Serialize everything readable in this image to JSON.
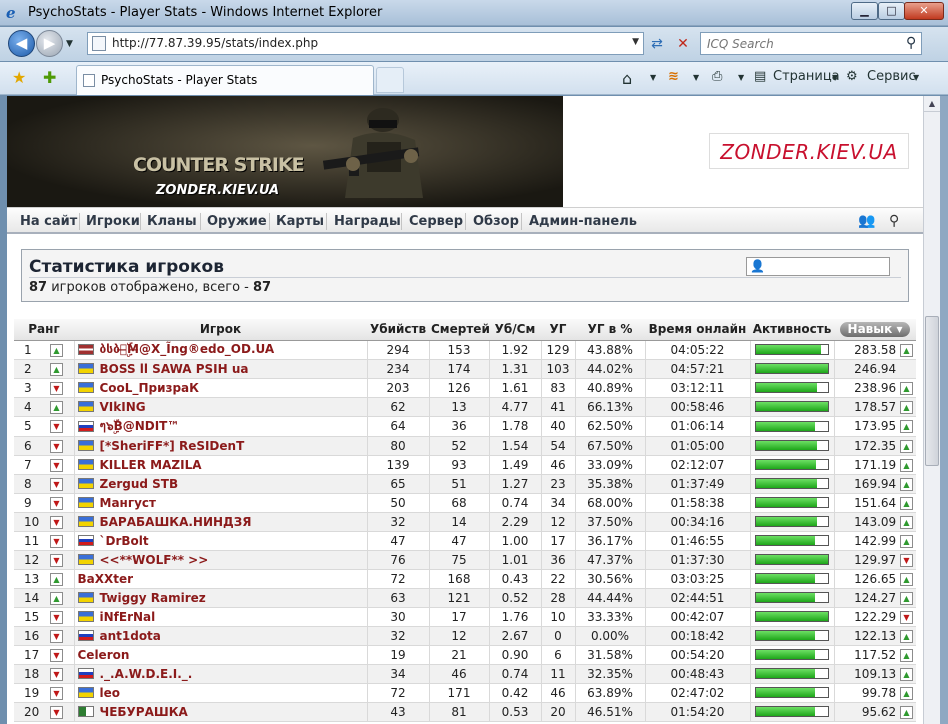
{
  "window": {
    "title": "PsychoStats - Player Stats - Windows Internet Explorer",
    "min": "▁",
    "max": "□",
    "close": "✕"
  },
  "address": {
    "url": "http://77.87.39.95/stats/index.php",
    "search_placeholder": "ICQ Search"
  },
  "tab": {
    "label": "PsychoStats - Player Stats"
  },
  "tools": {
    "page": "Страница",
    "service": "Сервис"
  },
  "icons": {
    "back": "arrow-left-icon",
    "forward": "arrow-right-icon",
    "refresh": "refresh-icon",
    "stop": "stop-icon",
    "search": "search-icon",
    "home": "home-icon",
    "feeds": "rss-icon",
    "print": "print-icon",
    "favorites": "star-icon",
    "add_favorite": "add-favorite-icon",
    "users": "users-icon",
    "magnifier": "magnifier-icon"
  },
  "banner": {
    "title": "COUNTER STRIKE",
    "site": "ZONDER.KIEV.UA",
    "site_right": "ZONDER.KIEV.UA"
  },
  "menu": [
    "На сайт",
    "Игроки",
    "Кланы",
    "Оружие",
    "Карты",
    "Награды",
    "Сервер",
    "Обзор",
    "Админ-панель"
  ],
  "stats": {
    "title": "Статистика игроков",
    "shown": "87",
    "shown_text": " игроков отображено, всего - ",
    "total": "87"
  },
  "colors": {
    "accent_nick": "#8b1a1a",
    "bar": "#1ea61a",
    "up": "#2f9a2f",
    "down": "#c01818"
  },
  "table": {
    "headers": {
      "rank": "Ранг",
      "player": "Игрок",
      "kills": "Убийств",
      "deaths": "Смертей",
      "kd": "Уб/См",
      "hs": "УГ",
      "hsp": "УГ в %",
      "online": "Время онлайн",
      "activity": "Активность",
      "skill": "Навык"
    },
    "rows": [
      {
        "rank": "1",
        "dir": "up",
        "flag": "lv",
        "name": "ბსბ๖̶ۣۜM̶@X_Ĩng®edo_OD.UA",
        "kills": "294",
        "deaths": "153",
        "kd": "1.92",
        "hs": "129",
        "hsp": "43.88%",
        "online": "04:05:22",
        "activity": 0.9,
        "skill": "283.58",
        "sdir": "up"
      },
      {
        "rank": "2",
        "dir": "up",
        "flag": "ua",
        "name": "BOSS ll SAWA PSIH ua",
        "kills": "234",
        "deaths": "174",
        "kd": "1.31",
        "hs": "103",
        "hsp": "44.02%",
        "online": "04:57:21",
        "activity": 1.0,
        "skill": "246.94",
        "sdir": ""
      },
      {
        "rank": "3",
        "dir": "dn",
        "flag": "ua",
        "name": "CooL_ПризраК",
        "kills": "203",
        "deaths": "126",
        "kd": "1.61",
        "hs": "83",
        "hsp": "40.89%",
        "online": "03:12:11",
        "activity": 0.85,
        "skill": "238.96",
        "sdir": "up"
      },
      {
        "rank": "4",
        "dir": "up",
        "flag": "ua",
        "name": "VIkING",
        "kills": "62",
        "deaths": "13",
        "kd": "4.77",
        "hs": "41",
        "hsp": "66.13%",
        "online": "00:58:46",
        "activity": 1.0,
        "skill": "178.57",
        "sdir": "up"
      },
      {
        "rank": "5",
        "dir": "dn",
        "flag": "ru",
        "name": "ๆ๖ۣۜB@NDIT™",
        "kills": "64",
        "deaths": "36",
        "kd": "1.78",
        "hs": "40",
        "hsp": "62.50%",
        "online": "01:06:14",
        "activity": 0.82,
        "skill": "173.95",
        "sdir": "up"
      },
      {
        "rank": "6",
        "dir": "dn",
        "flag": "ua",
        "name": "[*SheriFF*] ReSIDenT",
        "kills": "80",
        "deaths": "52",
        "kd": "1.54",
        "hs": "54",
        "hsp": "67.50%",
        "online": "01:05:00",
        "activity": 0.85,
        "skill": "172.35",
        "sdir": "up"
      },
      {
        "rank": "7",
        "dir": "dn",
        "flag": "ua",
        "name": "KILLER MAZILA",
        "kills": "139",
        "deaths": "93",
        "kd": "1.49",
        "hs": "46",
        "hsp": "33.09%",
        "online": "02:12:07",
        "activity": 0.83,
        "skill": "171.19",
        "sdir": "up"
      },
      {
        "rank": "8",
        "dir": "dn",
        "flag": "ua",
        "name": "Zergud STB",
        "kills": "65",
        "deaths": "51",
        "kd": "1.27",
        "hs": "23",
        "hsp": "35.38%",
        "online": "01:37:49",
        "activity": 0.85,
        "skill": "169.94",
        "sdir": "up"
      },
      {
        "rank": "9",
        "dir": "dn",
        "flag": "ua",
        "name": "Мангуст",
        "kills": "50",
        "deaths": "68",
        "kd": "0.74",
        "hs": "34",
        "hsp": "68.00%",
        "online": "01:58:38",
        "activity": 0.85,
        "skill": "151.64",
        "sdir": "up"
      },
      {
        "rank": "10",
        "dir": "dn",
        "flag": "ua",
        "name": "БАРАБАШКА.НИНДЗЯ",
        "kills": "32",
        "deaths": "14",
        "kd": "2.29",
        "hs": "12",
        "hsp": "37.50%",
        "online": "00:34:16",
        "activity": 0.85,
        "skill": "143.09",
        "sdir": "up"
      },
      {
        "rank": "11",
        "dir": "dn",
        "flag": "ru",
        "name": "`DrBolt",
        "kills": "47",
        "deaths": "47",
        "kd": "1.00",
        "hs": "17",
        "hsp": "36.17%",
        "online": "01:46:55",
        "activity": 0.82,
        "skill": "142.99",
        "sdir": "up"
      },
      {
        "rank": "12",
        "dir": "dn",
        "flag": "ua",
        "name": "<<**WOLF** >>",
        "kills": "76",
        "deaths": "75",
        "kd": "1.01",
        "hs": "36",
        "hsp": "47.37%",
        "online": "01:37:30",
        "activity": 1.0,
        "skill": "129.97",
        "sdir": "dn"
      },
      {
        "rank": "13",
        "dir": "up",
        "flag": "",
        "name": "BaXXter",
        "kills": "72",
        "deaths": "168",
        "kd": "0.43",
        "hs": "22",
        "hsp": "30.56%",
        "online": "03:03:25",
        "activity": 0.82,
        "skill": "126.65",
        "sdir": "up"
      },
      {
        "rank": "14",
        "dir": "up",
        "flag": "ua",
        "name": "Twiggy Ramirez",
        "kills": "63",
        "deaths": "121",
        "kd": "0.52",
        "hs": "28",
        "hsp": "44.44%",
        "online": "02:44:51",
        "activity": 0.82,
        "skill": "124.27",
        "sdir": "up"
      },
      {
        "rank": "15",
        "dir": "dn",
        "flag": "ua",
        "name": "iNfErNal",
        "kills": "30",
        "deaths": "17",
        "kd": "1.76",
        "hs": "10",
        "hsp": "33.33%",
        "online": "00:42:07",
        "activity": 1.0,
        "skill": "122.29",
        "sdir": "dn"
      },
      {
        "rank": "16",
        "dir": "dn",
        "flag": "ru",
        "name": "ant1dota",
        "kills": "32",
        "deaths": "12",
        "kd": "2.67",
        "hs": "0",
        "hsp": "0.00%",
        "online": "00:18:42",
        "activity": 0.82,
        "skill": "122.13",
        "sdir": "up"
      },
      {
        "rank": "17",
        "dir": "dn",
        "flag": "",
        "name": "Celeron",
        "kills": "19",
        "deaths": "21",
        "kd": "0.90",
        "hs": "6",
        "hsp": "31.58%",
        "online": "00:54:20",
        "activity": 0.82,
        "skill": "117.52",
        "sdir": "up"
      },
      {
        "rank": "18",
        "dir": "dn",
        "flag": "ru",
        "name": "._.A.W.D.E.I._.",
        "kills": "34",
        "deaths": "46",
        "kd": "0.74",
        "hs": "11",
        "hsp": "32.35%",
        "online": "00:48:43",
        "activity": 0.82,
        "skill": "109.13",
        "sdir": "up"
      },
      {
        "rank": "19",
        "dir": "dn",
        "flag": "ua",
        "name": "leo",
        "kills": "72",
        "deaths": "171",
        "kd": "0.42",
        "hs": "46",
        "hsp": "63.89%",
        "online": "02:47:02",
        "activity": 0.82,
        "skill": "99.78",
        "sdir": "up"
      },
      {
        "rank": "20",
        "dir": "dn",
        "flag": "dz",
        "name": "ЧЕБУРАШКА",
        "kills": "43",
        "deaths": "81",
        "kd": "0.53",
        "hs": "20",
        "hsp": "46.51%",
        "online": "01:54:20",
        "activity": 0.82,
        "skill": "95.62",
        "sdir": "up"
      }
    ]
  }
}
